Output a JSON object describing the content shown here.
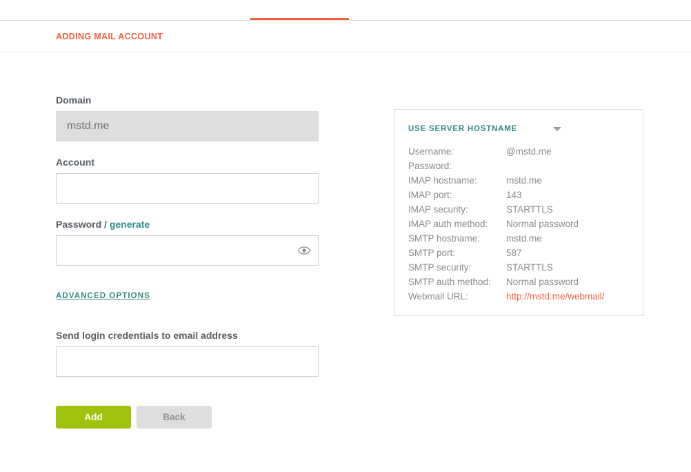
{
  "tabstrip": {
    "active_tab_indicator": "active-tab-underline"
  },
  "header": {
    "title": "ADDING MAIL ACCOUNT"
  },
  "form": {
    "domain": {
      "label": "Domain",
      "value": "mstd.me",
      "placeholder": ""
    },
    "account": {
      "label": "Account",
      "value": "",
      "placeholder": ""
    },
    "password": {
      "label_main": "Password /",
      "label_link": "generate",
      "value": "",
      "placeholder": "",
      "toggle_icon": "eye-icon"
    },
    "advanced_options": {
      "label": "ADVANCED OPTIONS"
    },
    "send_credentials": {
      "label": "Send login credentials to email address",
      "value": "",
      "placeholder": ""
    },
    "buttons": {
      "submit": "Add",
      "back": "Back"
    }
  },
  "info_panel": {
    "title": "USE SERVER HOSTNAME",
    "caret_icon": "chevron-down-icon",
    "rows": [
      {
        "key": "Username:",
        "value": "@mstd.me",
        "is_url": false
      },
      {
        "key": "Password:",
        "value": "",
        "is_url": false
      },
      {
        "key": "IMAP hostname:",
        "value": "mstd.me",
        "is_url": false
      },
      {
        "key": "IMAP port:",
        "value": "143",
        "is_url": false
      },
      {
        "key": "IMAP security:",
        "value": "STARTTLS",
        "is_url": false
      },
      {
        "key": "IMAP auth method:",
        "value": "Normal password",
        "is_url": false
      },
      {
        "key": "SMTP hostname:",
        "value": "mstd.me",
        "is_url": false
      },
      {
        "key": "SMTP port:",
        "value": "587",
        "is_url": false
      },
      {
        "key": "SMTP security:",
        "value": "STARTTLS",
        "is_url": false
      },
      {
        "key": "SMTP auth method:",
        "value": "Normal password",
        "is_url": false
      },
      {
        "key": "Webmail URL:",
        "value": "http://mstd.me/webmail/",
        "is_url": true
      }
    ]
  },
  "colors": {
    "accent_orange": "#f4613f",
    "accent_teal": "#2e8b8b",
    "button_green": "#9fc20c",
    "button_gray": "#dedede",
    "label_gray": "#555c63",
    "value_gray": "#8a8a8a",
    "border_gray": "#dcdcdc",
    "disabled_bg": "#dedede"
  }
}
